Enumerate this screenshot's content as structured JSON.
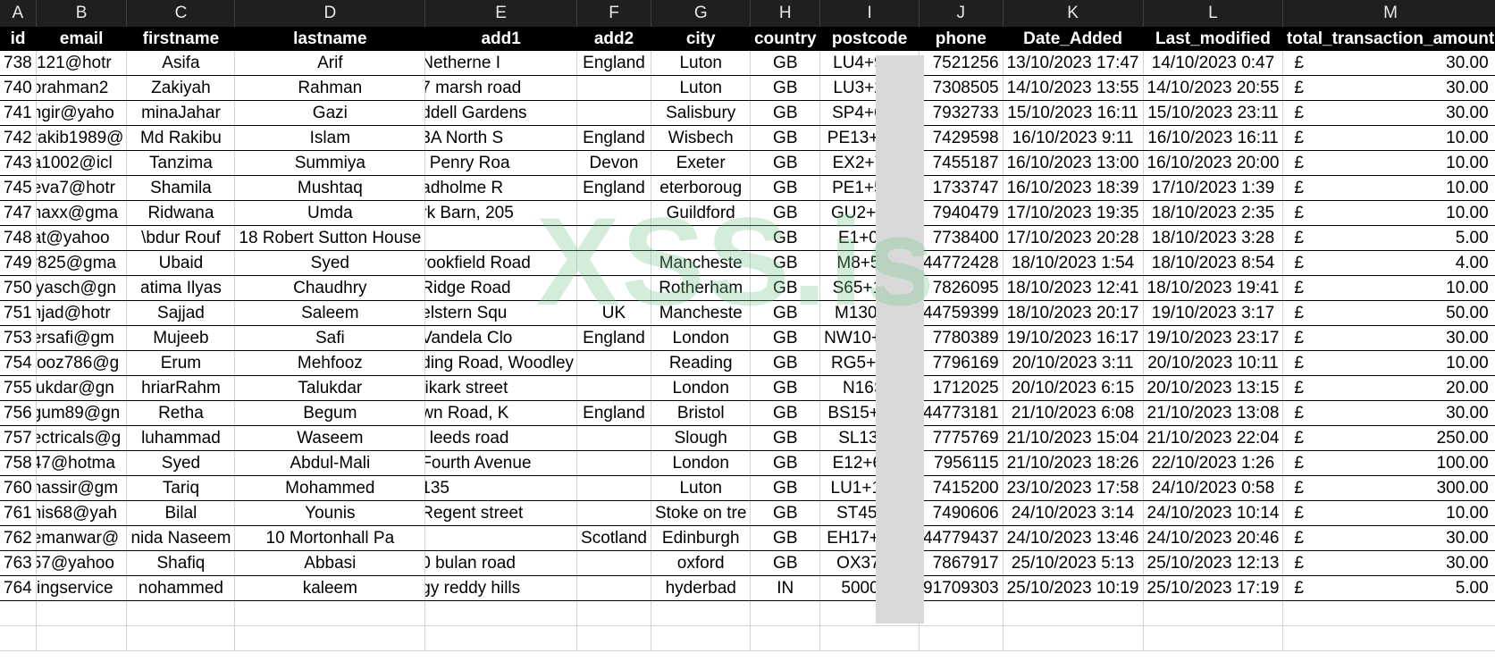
{
  "column_letters": [
    "A",
    "B",
    "C",
    "D",
    "E",
    "F",
    "G",
    "H",
    "I",
    "J",
    "K",
    "L",
    "M"
  ],
  "headers": [
    "id",
    "email",
    "firstname",
    "lastname",
    "add1",
    "add2",
    "city",
    "country",
    "postcode",
    "phone",
    "Date_Added",
    "Last_modified",
    "total_transaction_amount"
  ],
  "currency_symbol": "£",
  "rows": [
    [
      "738",
      "f121@hotr",
      "Asifa",
      "Arif",
      "Netherne I",
      "England",
      "Luton",
      "GB",
      "LU4+9PE",
      "7521256",
      "13/10/2023 17:47",
      "14/10/2023 0:47",
      "30.00"
    ],
    [
      "740",
      "orahman2",
      "Zakiyah",
      "Rahman",
      "7 marsh road",
      "",
      "Luton",
      "GB",
      "LU3+2RT",
      "7308505",
      "14/10/2023 13:55",
      "14/10/2023 20:55",
      "30.00"
    ],
    [
      "741",
      "ngir@yaho",
      "minaJahar",
      "Gazi",
      "ddell Gardens",
      "",
      "Salisbury",
      "GB",
      "SP4+6SD",
      "7932733",
      "15/10/2023 16:11",
      "15/10/2023 23:11",
      "30.00"
    ],
    [
      "742",
      "rakib1989@",
      "Md Rakibu",
      "Islam",
      "3A North S",
      "England",
      "Wisbech",
      "GB",
      "PE13+1NP",
      "7429598",
      "16/10/2023 9:11",
      "16/10/2023 16:11",
      "10.00"
    ],
    [
      "743",
      "a1002@icl",
      "Tanzima",
      "Summiya",
      "i Penry Roa",
      "Devon",
      "Exeter",
      "GB",
      "EX2+7SX",
      "7455187",
      "16/10/2023 13:00",
      "16/10/2023 20:00",
      "10.00"
    ],
    [
      "745",
      "eva7@hotr",
      "Shamila",
      "Mushtaq",
      "adholme R",
      "England",
      "eterboroug",
      "GB",
      "PE1+5EH",
      "1733747",
      "16/10/2023 18:39",
      "17/10/2023 1:39",
      "10.00"
    ],
    [
      "747",
      "naxx@gma",
      "Ridwana",
      "Umda",
      "rk Barn, 205",
      "",
      "Guildford",
      "GB",
      "GU2+8EX",
      "7940479",
      "17/10/2023 19:35",
      "18/10/2023 2:35",
      "10.00"
    ],
    [
      "748",
      "at@yahoo",
      "\\bdur  Rouf",
      "18 Robert Sutton House",
      "",
      "",
      "",
      "GB",
      "E1+0BA",
      "7738400",
      "17/10/2023 20:28",
      "18/10/2023 3:28",
      "5.00"
    ],
    [
      "749",
      "r825@gma",
      "Ubaid",
      "Syed",
      "rookfield Road",
      "",
      "Mancheste",
      "GB",
      "M8+5SE",
      "44772428",
      "18/10/2023 1:54",
      "18/10/2023 8:54",
      "4.00"
    ],
    [
      "750",
      "lyasch@gn",
      "atima Ilyas",
      "Chaudhry",
      "Ridge Road",
      "",
      "Rotherham",
      "GB",
      "S65+1PG",
      "7826095",
      "18/10/2023 12:41",
      "18/10/2023 19:41",
      "10.00"
    ],
    [
      "751",
      "njad@hotr",
      "Sajjad",
      "Saleem",
      "elstern Squ",
      "UK",
      "Mancheste",
      "GB",
      "M130XW",
      "44759399",
      "18/10/2023 20:17",
      "19/10/2023 3:17",
      "50.00"
    ],
    [
      "753",
      "ersafi@gm",
      "Mujeeb",
      "Safi",
      "Vandela Clo",
      "England",
      "London",
      "GB",
      "NW10+8BG",
      "7780389",
      "19/10/2023 16:17",
      "19/10/2023 23:17",
      "30.00"
    ],
    [
      "754",
      "fooz786@g",
      "Erum",
      "Mehfooz",
      "ding Road, Woodley",
      "",
      "Reading",
      "GB",
      "RG5+3AA",
      "7796169",
      "20/10/2023 3:11",
      "20/10/2023 10:11",
      "10.00"
    ],
    [
      "755",
      "lukdar@gn",
      "hriarRahm",
      "Talukdar",
      "likark street",
      "",
      "London",
      "GB",
      "N16SA",
      "1712025",
      "20/10/2023 6:15",
      "20/10/2023 13:15",
      "20.00"
    ],
    [
      "756",
      "gum89@gn",
      "Retha",
      "Begum",
      "wn Road, K",
      "England",
      "Bristol",
      "GB",
      "BS15+1XA",
      "44773181",
      "21/10/2023 6:08",
      "21/10/2023 13:08",
      "30.00"
    ],
    [
      "757",
      "ectricals@g",
      "luhammad",
      "Waseem",
      "i leeds road",
      "",
      "Slough",
      "GB",
      "SL13PX",
      "7775769",
      "21/10/2023 15:04",
      "21/10/2023 22:04",
      "250.00"
    ],
    [
      "758",
      "47@hotma",
      "Syed",
      "Abdul-Mali",
      "Fourth Avenue",
      "",
      "London",
      "GB",
      "E12+6DR",
      "7956115",
      "21/10/2023 18:26",
      "22/10/2023 1:26",
      "100.00"
    ],
    [
      "760",
      "hassir@gm",
      "Tariq",
      "Mohammed",
      "135",
      "",
      "Luton",
      "GB",
      "LU1+1BW",
      "7415200",
      "23/10/2023 17:58",
      "24/10/2023 0:58",
      "300.00"
    ],
    [
      "761",
      "nis68@yah",
      "Bilal",
      "Younis",
      "Regent street",
      "",
      "Stoke on tre",
      "GB",
      "ST45HQ",
      "7490606",
      "24/10/2023 3:14",
      "24/10/2023 10:14",
      "10.00"
    ],
    [
      "762",
      "emanwar@",
      "nida  Naseem",
      "10 Mortonhall Pa",
      "",
      "Scotland",
      "Edinburgh",
      "GB",
      "EH17+8SN",
      "44779437",
      "24/10/2023 13:46",
      "24/10/2023 20:46",
      "30.00"
    ],
    [
      "763",
      "57@yahoo",
      "Shafiq",
      "Abbasi",
      "0 bulan road",
      "",
      "oxford",
      "GB",
      "OX37HT",
      "7867917",
      "25/10/2023 5:13",
      "25/10/2023 12:13",
      "30.00"
    ],
    [
      "764",
      "tingservice",
      "nohammed",
      "kaleem",
      "gy reddy hills",
      "",
      "hyderbad",
      "IN",
      "500005",
      "91709303",
      "25/10/2023 10:19",
      "25/10/2023 17:19",
      "5.00"
    ]
  ],
  "watermark_text": "XSS.is"
}
